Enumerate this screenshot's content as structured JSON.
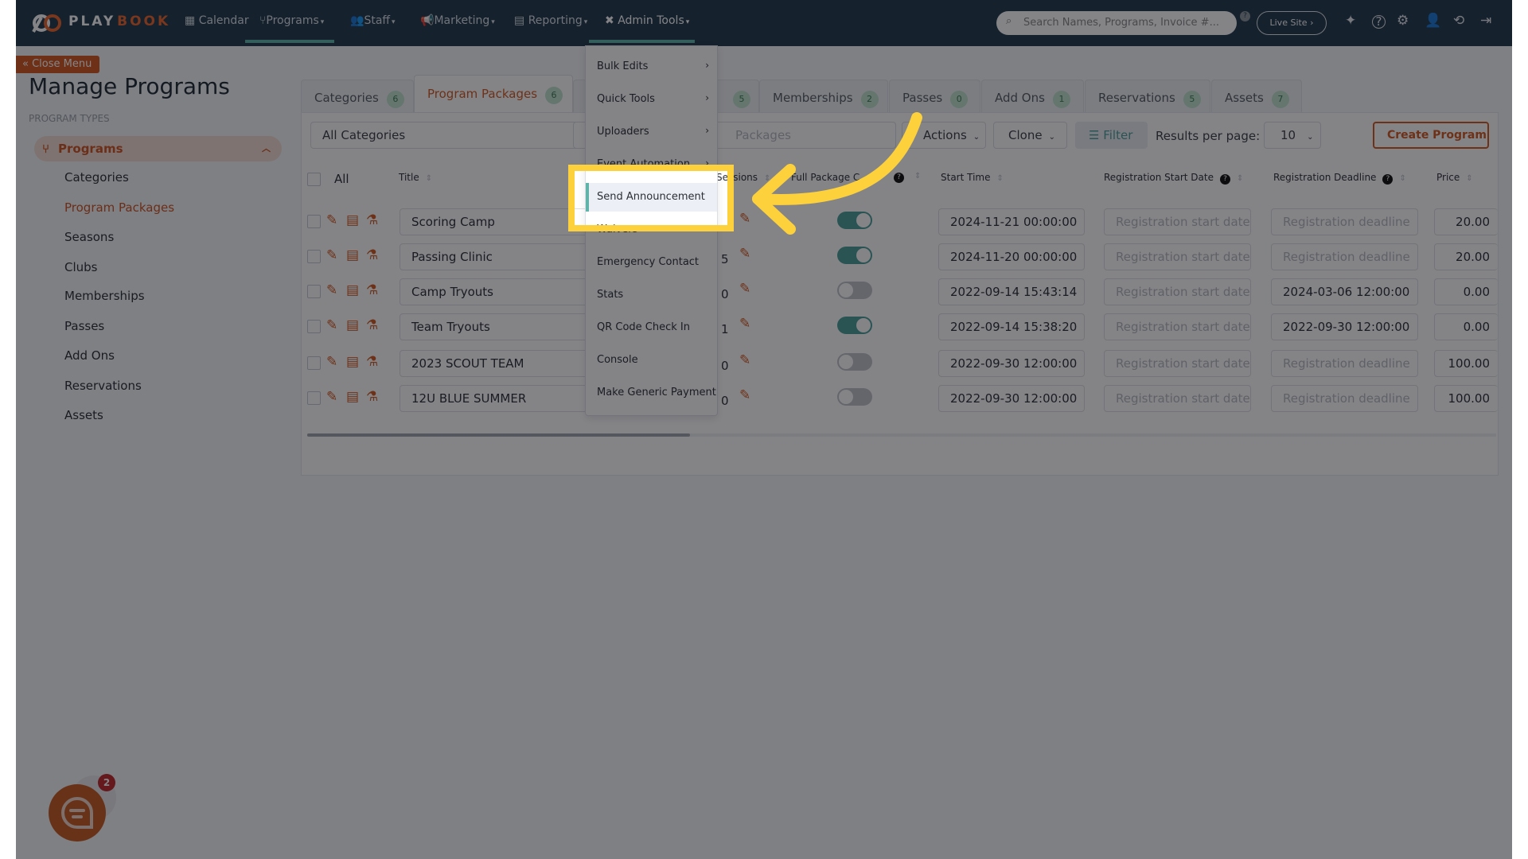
{
  "colors": {
    "brand_orange": "#d0581f",
    "nav_bg": "#20384a",
    "teal": "#4a9f96",
    "highlight": "#fdd13b"
  },
  "nav": {
    "logo_play": "PLAY",
    "logo_book": "BOOK",
    "items": [
      {
        "label": "Calendar",
        "icon": "calendar-icon"
      },
      {
        "label": "Programs",
        "icon": "branch-icon"
      },
      {
        "label": "Staff",
        "icon": "users-icon"
      },
      {
        "label": "Marketing",
        "icon": "megaphone-icon"
      },
      {
        "label": "Reporting",
        "icon": "document-icon"
      },
      {
        "label": "Admin Tools",
        "icon": "tools-icon"
      }
    ],
    "search_placeholder": "Search Names, Programs, Invoice #...",
    "live_site": "Live Site"
  },
  "sidebar": {
    "close_menu": "Close Menu",
    "title": "Manage Programs",
    "section": "PROGRAM TYPES",
    "group": "Programs",
    "items": [
      "Categories",
      "Program Packages",
      "Seasons",
      "Clubs",
      "Memberships",
      "Passes",
      "Add Ons",
      "Reservations",
      "Assets"
    ],
    "active": "Program Packages"
  },
  "tabs": [
    {
      "label": "Categories",
      "count": "6"
    },
    {
      "label": "Program Packages",
      "count": "6",
      "active": true
    },
    {
      "label": "",
      "count": "5"
    },
    {
      "label": "Memberships",
      "count": "2"
    },
    {
      "label": "Passes",
      "count": "0"
    },
    {
      "label": "Add Ons",
      "count": "1"
    },
    {
      "label": "Reservations",
      "count": "5"
    },
    {
      "label": "Assets",
      "count": "7"
    }
  ],
  "toolbar": {
    "category_select": "All Categories",
    "search_placeholder": "Packages",
    "actions": "Actions",
    "clone": "Clone",
    "filter": "Filter",
    "results_label": "Results per page:",
    "results_value": "10",
    "create": "Create Program"
  },
  "table": {
    "headers": {
      "all": "All",
      "title": "Title",
      "sessions": "Sessions",
      "full_package": "Full Package C",
      "start_time": "Start Time",
      "reg_start": "Registration Start Date",
      "reg_deadline": "Registration Deadline",
      "price": "Price"
    },
    "rows": [
      {
        "title": "Scoring Camp",
        "count": "",
        "full_package": true,
        "start": "2024-11-21 00:00:00",
        "reg_start": "",
        "reg_deadline": "",
        "price": "20.00"
      },
      {
        "title": "Passing Clinic",
        "count": "5",
        "full_package": true,
        "start": "2024-11-20 00:00:00",
        "reg_start": "",
        "reg_deadline": "",
        "price": "20.00"
      },
      {
        "title": "Camp Tryouts",
        "count": "0",
        "full_package": false,
        "start": "2022-09-14 15:43:14",
        "reg_start": "",
        "reg_deadline": "2024-03-06 12:00:00",
        "price": "0.00"
      },
      {
        "title": "Team Tryouts",
        "count": "1",
        "full_package": true,
        "start": "2022-09-14 15:38:20",
        "reg_start": "",
        "reg_deadline": "2022-09-30 12:00:00",
        "price": "0.00"
      },
      {
        "title": "2023 SCOUT TEAM",
        "count": "0",
        "full_package": false,
        "start": "2022-09-30 12:00:00",
        "reg_start": "",
        "reg_deadline": "",
        "price": "100.00"
      },
      {
        "title": "12U BLUE SUMMER",
        "count": "0",
        "full_package": false,
        "start": "2022-09-30 12:00:00",
        "reg_start": "",
        "reg_deadline": "",
        "price": "100.00"
      }
    ],
    "reg_start_placeholder": "Registration start date",
    "reg_deadline_placeholder": "Registration deadline"
  },
  "admin_menu": {
    "items": [
      {
        "label": "Bulk Edits",
        "submenu": true
      },
      {
        "label": "Quick Tools",
        "submenu": true
      },
      {
        "label": "Uploaders",
        "submenu": true
      },
      {
        "label": "Event Automation",
        "submenu": true
      },
      {
        "label": "Send Announcement",
        "submenu": false,
        "highlighted": true
      },
      {
        "label": "Waivers",
        "submenu": false
      },
      {
        "label": "Emergency Contact",
        "submenu": false
      },
      {
        "label": "Stats",
        "submenu": false
      },
      {
        "label": "QR Code Check In",
        "submenu": false
      },
      {
        "label": "Console",
        "submenu": false
      },
      {
        "label": "Make Generic Payment",
        "submenu": false
      }
    ]
  },
  "chat": {
    "badge": "2"
  }
}
